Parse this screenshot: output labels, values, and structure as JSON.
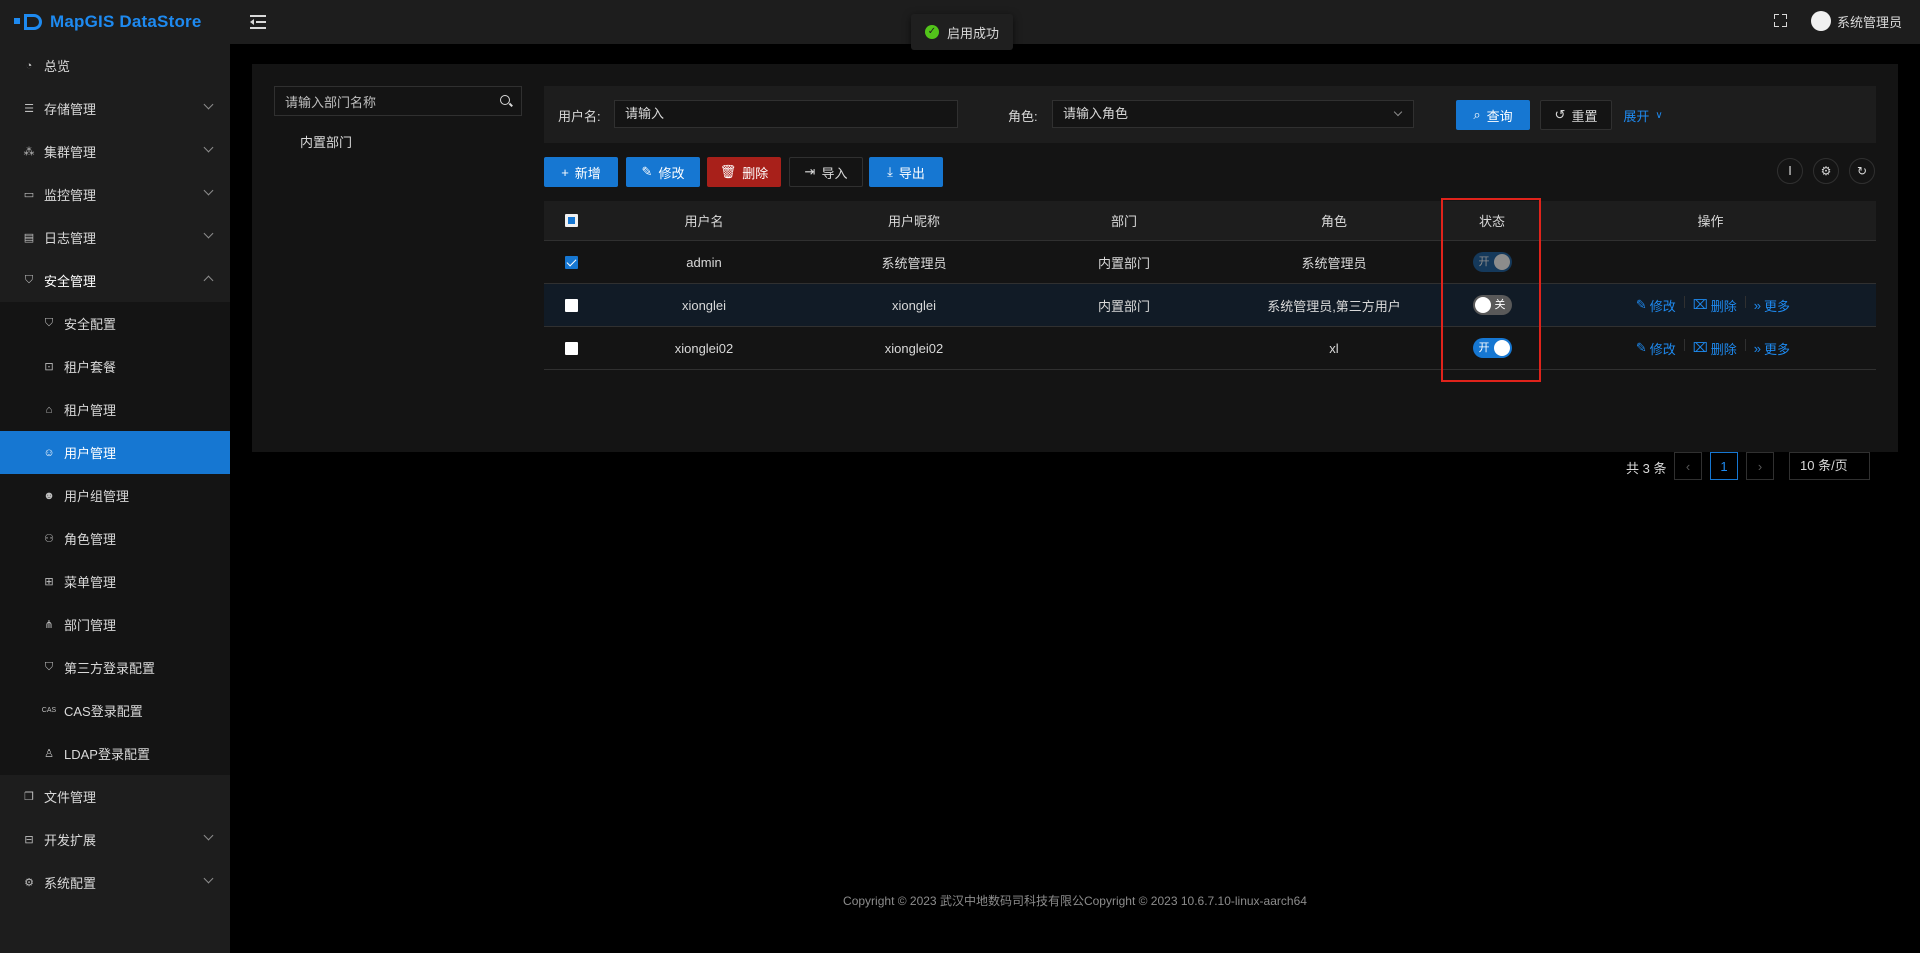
{
  "app": {
    "title": "MapGIS DataStore"
  },
  "sidebar": {
    "items": [
      {
        "label": "总览",
        "icon": "dashboard-icon"
      },
      {
        "label": "存储管理",
        "icon": "storage-icon"
      },
      {
        "label": "集群管理",
        "icon": "cluster-icon"
      },
      {
        "label": "监控管理",
        "icon": "monitor-icon"
      },
      {
        "label": "日志管理",
        "icon": "log-icon"
      },
      {
        "label": "安全管理",
        "icon": "shield-icon"
      },
      {
        "label": "文件管理",
        "icon": "file-icon"
      },
      {
        "label": "开发扩展",
        "icon": "briefcase-icon"
      },
      {
        "label": "系统配置",
        "icon": "gear-icon"
      }
    ],
    "security_sub": [
      {
        "label": "安全配置"
      },
      {
        "label": "租户套餐"
      },
      {
        "label": "租户管理"
      },
      {
        "label": "用户管理"
      },
      {
        "label": "用户组管理"
      },
      {
        "label": "角色管理"
      },
      {
        "label": "菜单管理"
      },
      {
        "label": "部门管理"
      },
      {
        "label": "第三方登录配置"
      },
      {
        "label": "CAS登录配置"
      },
      {
        "label": "LDAP登录配置"
      }
    ]
  },
  "header": {
    "toast": "启用成功",
    "user_name": "系统管理员"
  },
  "dept": {
    "search_placeholder": "请输入部门名称",
    "node": "内置部门"
  },
  "query": {
    "username_label": "用户名:",
    "username_placeholder": "请输入",
    "role_label": "角色:",
    "role_placeholder": "请输入角色",
    "search_btn": "查询",
    "reset_btn": "重置",
    "expand_link": "展开"
  },
  "toolbar": {
    "add": "新增",
    "edit": "修改",
    "delete": "删除",
    "import": "导入",
    "export": "导出"
  },
  "table": {
    "columns": [
      "用户名",
      "用户昵称",
      "部门",
      "角色",
      "状态",
      "操作"
    ],
    "rows": [
      {
        "username": "admin",
        "nickname": "系统管理员",
        "dept": "内置部门",
        "role": "系统管理员",
        "status": "开",
        "status_on": true,
        "checked": true
      },
      {
        "username": "xionglei",
        "nickname": "xionglei",
        "dept": "内置部门",
        "role": "系统管理员,第三方用户",
        "status": "关",
        "status_on": false,
        "checked": false
      },
      {
        "username": "xionglei02",
        "nickname": "xionglei02",
        "dept": "",
        "role": "xl",
        "status": "开",
        "status_on": true,
        "checked": false
      }
    ],
    "actions": {
      "edit": "修改",
      "delete": "删除",
      "more": "更多"
    }
  },
  "pagination": {
    "total": "共 3 条",
    "current": "1",
    "page_size": "10 条/页"
  },
  "footer": {
    "text": "Copyright © 2023 武汉中地数码司科技有限公Copyright © 2023 10.6.7.10-linux-aarch64"
  },
  "colors": {
    "accent": "#1677d2",
    "danger": "#a8201a",
    "highlight": "#e0231b"
  }
}
